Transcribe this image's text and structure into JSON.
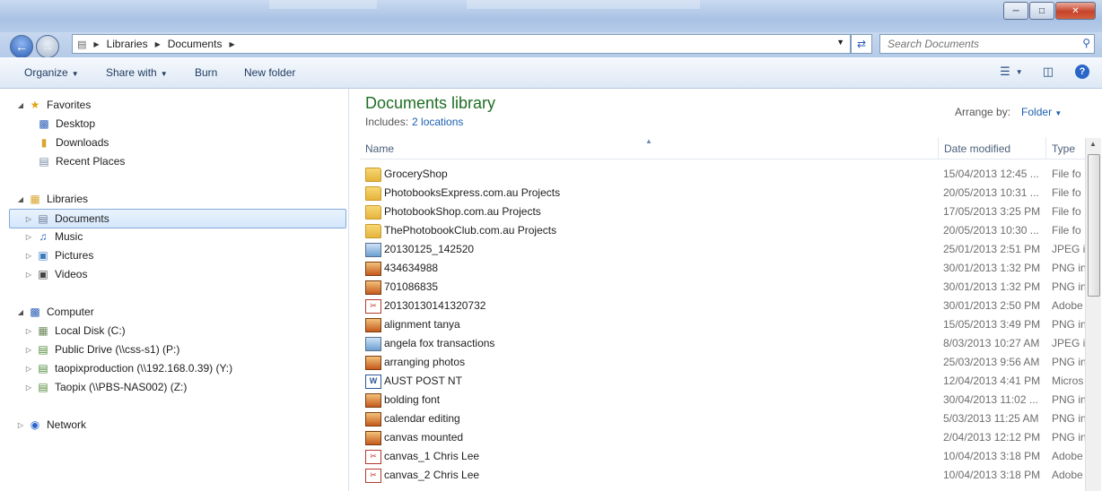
{
  "window": {
    "minimize_icon": "minimize-icon",
    "maximize_icon": "maximize-icon",
    "close_icon": "close-icon"
  },
  "address": {
    "segments": [
      "Libraries",
      "Documents"
    ],
    "search_placeholder": "Search Documents"
  },
  "toolbar": {
    "organize": "Organize",
    "share_with": "Share with",
    "burn": "Burn",
    "new_folder": "New folder"
  },
  "nav": {
    "favorites": {
      "label": "Favorites",
      "items": [
        "Desktop",
        "Downloads",
        "Recent Places"
      ]
    },
    "libraries": {
      "label": "Libraries",
      "items": [
        "Documents",
        "Music",
        "Pictures",
        "Videos"
      ]
    },
    "computer": {
      "label": "Computer",
      "items": [
        "Local Disk (C:)",
        "Public Drive (\\\\css-s1) (P:)",
        "taopixproduction (\\\\192.168.0.39) (Y:)",
        "Taopix (\\\\PBS-NAS002) (Z:)"
      ]
    },
    "network": {
      "label": "Network"
    }
  },
  "library": {
    "title": "Documents library",
    "includes_label": "Includes:",
    "includes_link": "2 locations",
    "arrange_label": "Arrange by:",
    "arrange_value": "Folder"
  },
  "columns": {
    "name": "Name",
    "date": "Date modified",
    "type": "Type"
  },
  "files": [
    {
      "name": "GroceryShop",
      "date": "15/04/2013 12:45 ...",
      "type": "File fo",
      "icon": "folder"
    },
    {
      "name": "PhotobooksExpress.com.au Projects",
      "date": "20/05/2013 10:31 ...",
      "type": "File fo",
      "icon": "folder"
    },
    {
      "name": "PhotobookShop.com.au Projects",
      "date": "17/05/2013 3:25 PM",
      "type": "File fo",
      "icon": "folder"
    },
    {
      "name": "ThePhotobookClub.com.au Projects",
      "date": "20/05/2013 10:30 ...",
      "type": "File fo",
      "icon": "folder"
    },
    {
      "name": "20130125_142520",
      "date": "25/01/2013 2:51 PM",
      "type": "JPEG in",
      "icon": "jpeg"
    },
    {
      "name": "434634988",
      "date": "30/01/2013 1:32 PM",
      "type": "PNG in",
      "icon": "png"
    },
    {
      "name": "701086835",
      "date": "30/01/2013 1:32 PM",
      "type": "PNG in",
      "icon": "png"
    },
    {
      "name": "20130130141320732",
      "date": "30/01/2013 2:50 PM",
      "type": "Adobe",
      "icon": "pdf"
    },
    {
      "name": "alignment tanya",
      "date": "15/05/2013 3:49 PM",
      "type": "PNG in",
      "icon": "png"
    },
    {
      "name": "angela fox transactions",
      "date": "8/03/2013 10:27 AM",
      "type": "JPEG in",
      "icon": "jpeg"
    },
    {
      "name": "arranging photos",
      "date": "25/03/2013 9:56 AM",
      "type": "PNG in",
      "icon": "png"
    },
    {
      "name": "AUST POST NT",
      "date": "12/04/2013 4:41 PM",
      "type": "Micros",
      "icon": "doc"
    },
    {
      "name": "bolding font",
      "date": "30/04/2013 11:02 ...",
      "type": "PNG in",
      "icon": "png"
    },
    {
      "name": "calendar editing",
      "date": "5/03/2013 11:25 AM",
      "type": "PNG in",
      "icon": "png"
    },
    {
      "name": "canvas mounted",
      "date": "2/04/2013 12:12 PM",
      "type": "PNG in",
      "icon": "png"
    },
    {
      "name": "canvas_1 Chris Lee",
      "date": "10/04/2013 3:18 PM",
      "type": "Adobe",
      "icon": "pdf"
    },
    {
      "name": "canvas_2 Chris Lee",
      "date": "10/04/2013 3:18 PM",
      "type": "Adobe",
      "icon": "pdf"
    }
  ]
}
